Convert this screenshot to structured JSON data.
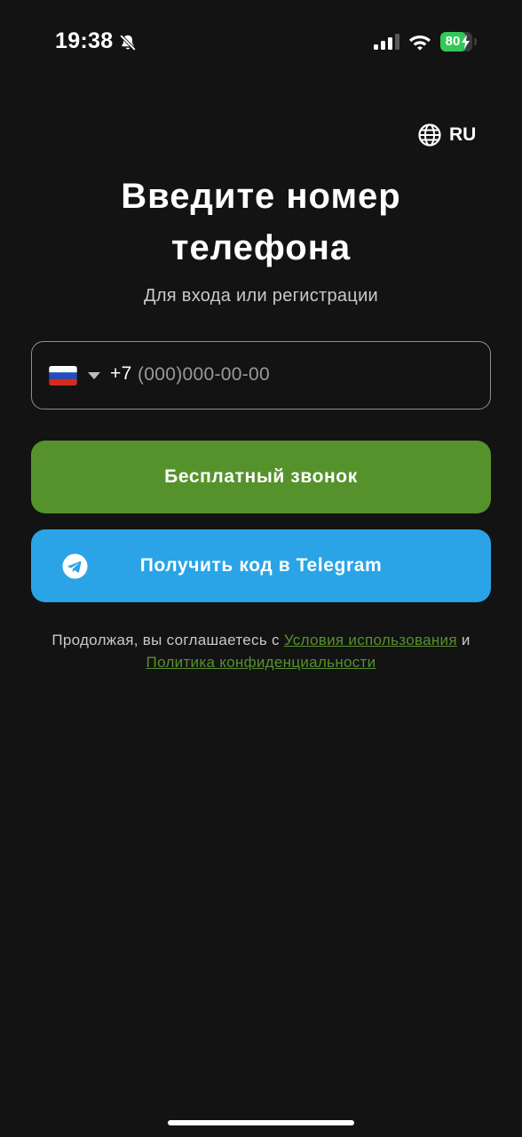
{
  "status_bar": {
    "time": "19:38",
    "battery_level": "80",
    "battery_fraction": 0.8,
    "icons": [
      "bell-slash-icon",
      "cellular-signal-icon",
      "wifi-icon",
      "battery-icon",
      "bolt-icon"
    ]
  },
  "language": {
    "icon": "globe-icon",
    "label": "RU"
  },
  "header": {
    "title_line1": "Введите номер",
    "title_line2": "телефона",
    "subtitle": "Для входа или регистрации"
  },
  "phone": {
    "country_flag": "russia-flag-icon",
    "prefix": "+7",
    "value": "",
    "placeholder": "(000)000-00-00"
  },
  "buttons": {
    "free_call_label": "Бесплатный звонок",
    "telegram_label": "Получить код в Telegram"
  },
  "legal": {
    "text_before": "Продолжая, вы соглашаетесь с",
    "terms_link": "Условия использования",
    "conjunction": "и",
    "privacy_link": "Политика конфиденциальности"
  },
  "colors": {
    "background": "#131313",
    "call_button": "#56922c",
    "telegram_button": "#2aa4e6",
    "link": "#56922c",
    "battery": "#34c759"
  }
}
